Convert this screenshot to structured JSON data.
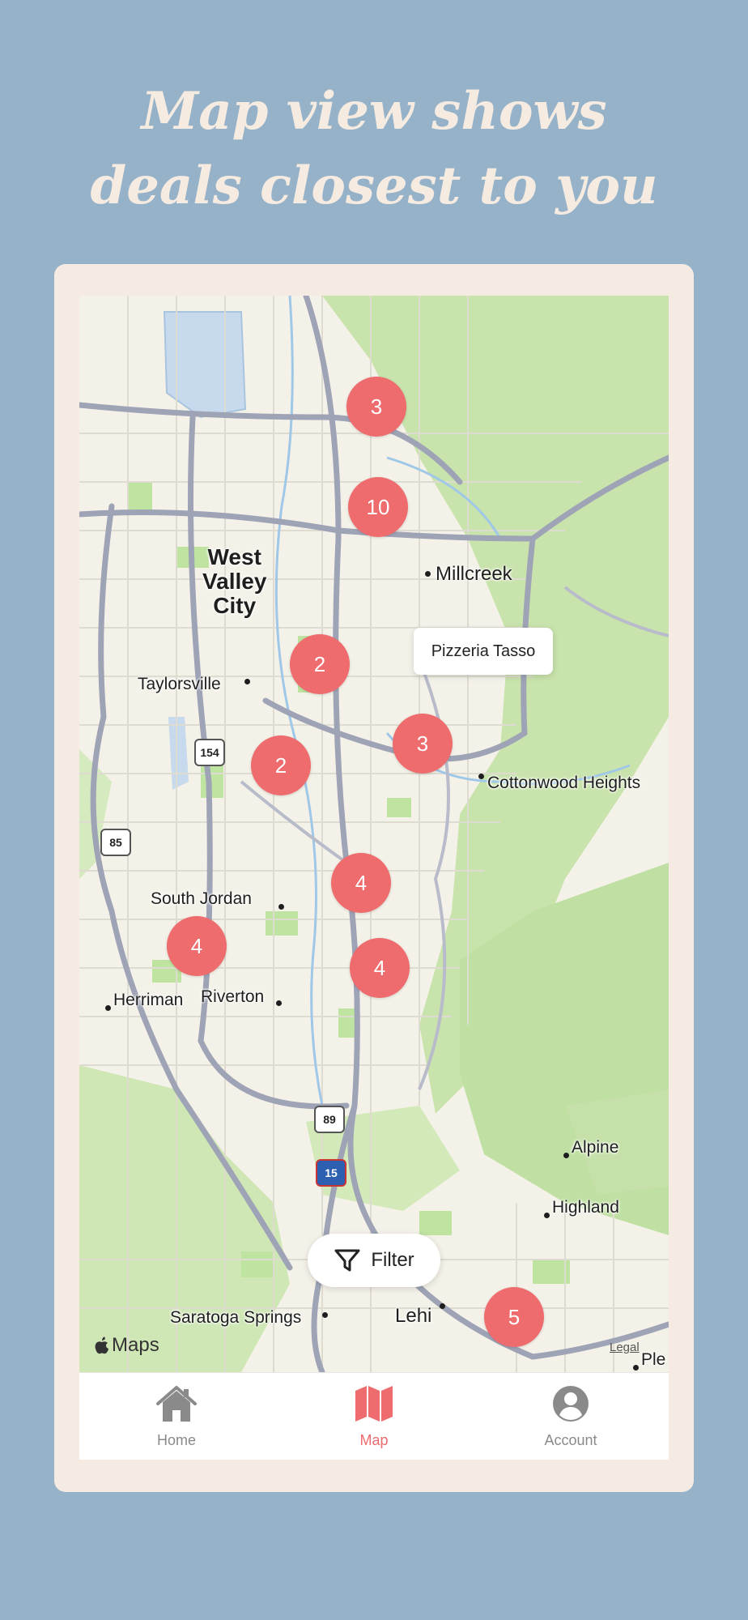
{
  "headline": {
    "line1": "Map view shows",
    "line2": "deals closest to you"
  },
  "map": {
    "places": {
      "west_valley_1": "West",
      "west_valley_2": "Valley",
      "west_valley_3": "City",
      "millcreek": "Millcreek",
      "taylorsville": "Taylorsville",
      "cottonwood": "Cottonwood Heights",
      "south_jordan": "South Jordan",
      "herriman": "Herriman",
      "riverton": "Riverton",
      "alpine": "Alpine",
      "highland": "Highland",
      "saratoga": "Saratoga Springs",
      "lehi": "Lehi",
      "ple": "Ple"
    },
    "shields": {
      "r154": "154",
      "r85": "85",
      "r89": "89",
      "i15": "15"
    },
    "clusters": [
      "3",
      "10",
      "2",
      "3",
      "2",
      "4",
      "4",
      "4",
      "5"
    ],
    "tooltip": "Pizzeria Tasso",
    "brand": "Maps",
    "legal": "Legal",
    "filter_label": "Filter"
  },
  "tabs": [
    {
      "label": "Home",
      "icon": "home-icon"
    },
    {
      "label": "Map",
      "icon": "map-icon"
    },
    {
      "label": "Account",
      "icon": "account-icon"
    }
  ],
  "colors": {
    "background": "#96b2c9",
    "headline": "#f6ebe1",
    "frame": "#f5ebe2",
    "cluster": "#ee6b6e",
    "active_tab": "#ee6b6e",
    "inactive_tab": "#8a8a8a"
  }
}
